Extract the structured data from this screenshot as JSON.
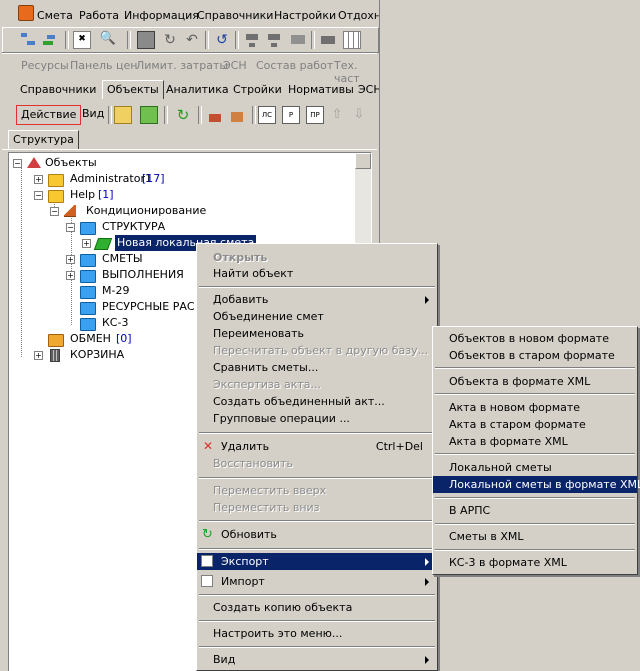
{
  "menubar": {
    "items": [
      "Смета",
      "Работа",
      "Информация",
      "Справочники",
      "Настройки",
      "Отдохн"
    ]
  },
  "toolbar3": {
    "items": [
      "Ресурсы",
      "Панель цен",
      "Лимит. затраты",
      "ЭСН",
      "Состав работ",
      "Тех. част"
    ]
  },
  "tabs_row": {
    "items": [
      "Справочники",
      "Объекты",
      "Аналитика",
      "Стройки",
      "Нормативы",
      "ЭСН"
    ]
  },
  "action_bar": {
    "action": "Действие",
    "view": "Вид"
  },
  "structure_tab": "Структура",
  "tree": {
    "root": "Объекты",
    "admin": {
      "label": "Administrator1",
      "count": "[17]"
    },
    "help": {
      "label": "Help",
      "count": "[1]"
    },
    "kond": "Кондиционирование",
    "struct": "СТРУКТУРА",
    "new_smeta": "Новая локальная смета",
    "smety": "СМЕТЫ",
    "vypoln": "ВЫПОЛНЕНИЯ",
    "m29": "М-29",
    "resursnye": "РЕСУРСНЫЕ РАС",
    "ks3": "КС-3",
    "obmen": {
      "label": "ОБМЕН",
      "count": "[0]"
    },
    "korzina": "КОРЗИНА"
  },
  "context_menu": {
    "open": "Открыть",
    "find": "Найти объект",
    "add": "Добавить",
    "merge": "Объединение смет",
    "rename": "Переименовать",
    "recalc": "Пересчитать объект в другую базу...",
    "compare": "Сравнить сметы...",
    "expertise": "Экспертиза акта...",
    "create_merged": "Создать объединенный акт...",
    "group_ops": "Групповые операции ...",
    "delete": "Удалить",
    "delete_shortcut": "Ctrl+Del",
    "restore": "Восстановить",
    "move_up": "Переместить вверх",
    "move_down": "Переместить вниз",
    "refresh": "Обновить",
    "export": "Экспорт",
    "import": "Импорт",
    "copy": "Создать копию объекта",
    "customize": "Настроить это меню...",
    "view": "Вид"
  },
  "export_menu": {
    "new_format": "Объектов в новом формате",
    "old_format": "Объектов в старом формате",
    "xml_obj": "Объекта в формате XML",
    "act_new": "Акта в новом формате",
    "act_old": "Акта в старом формате",
    "act_xml": "Акта в формате XML",
    "local": "Локальной сметы",
    "local_xml": "Локальной сметы в формате XML",
    "arps": "В АРПС",
    "smety_xml": "Сметы в XML",
    "ks3_xml": "КС-3 в формате XML"
  },
  "colors": {
    "selection": "#0a246a",
    "background": "#d4d0c8",
    "folder": "#f8c830",
    "blue_folder": "#3aa0f0",
    "delete": "#e0302a"
  }
}
